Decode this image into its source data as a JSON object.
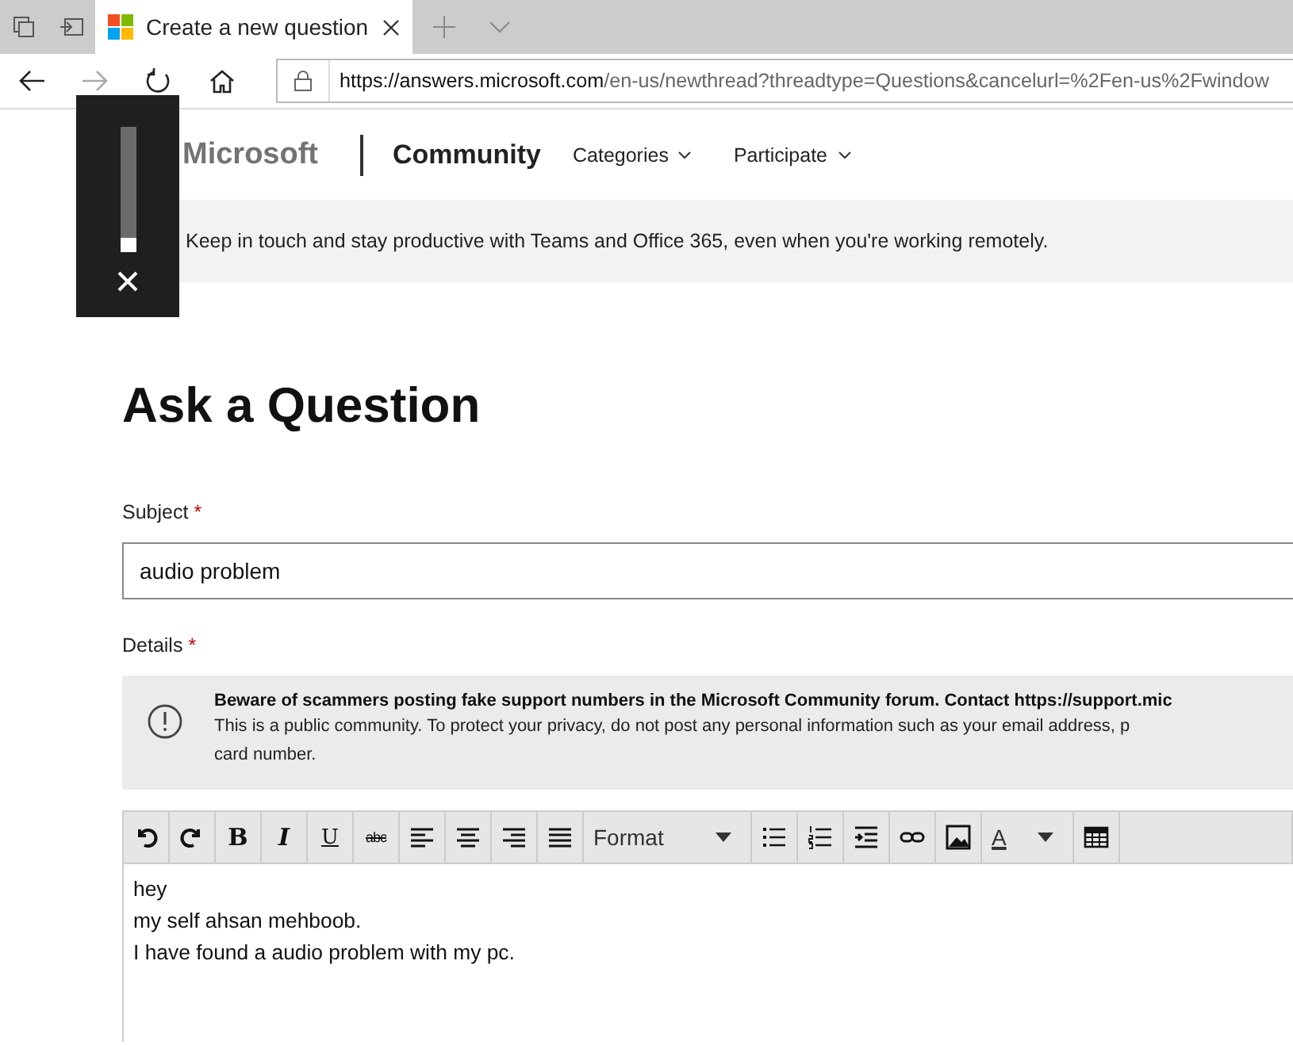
{
  "browser": {
    "tab": {
      "title": "Create a new question",
      "selected": true
    },
    "url": {
      "host": "https://answers.microsoft.com",
      "path": "/en-us/newthread?threadtype=Questions&cancelurl=%2Fen-us%2Fwindow"
    }
  },
  "header": {
    "brand": "Microsoft",
    "site": "Community",
    "menus": [
      "Categories",
      "Participate"
    ]
  },
  "banner": "Keep in touch and stay productive with Teams and Office 365, even when you're working remotely.",
  "form": {
    "title": "Ask a Question",
    "subject": {
      "label": "Subject",
      "required": "*",
      "value": "audio problem"
    },
    "details": {
      "label": "Details",
      "required": "*"
    },
    "warning": {
      "title": "Beware of scammers posting fake support numbers in the Microsoft Community forum. Contact https://support.mic",
      "text": "This is a public community. To protect your privacy, do not post any personal information such as your email address, p\ncard number."
    },
    "tools": [
      {
        "kind": "undo"
      },
      {
        "kind": "redo"
      },
      {
        "kind": "bold",
        "label": "B"
      },
      {
        "kind": "italic",
        "label": "I"
      },
      {
        "kind": "underline",
        "label": "U"
      },
      {
        "kind": "strike",
        "label": "abc"
      },
      {
        "kind": "align-left"
      },
      {
        "kind": "align-center"
      },
      {
        "kind": "align-right"
      },
      {
        "kind": "justify"
      },
      {
        "kind": "dropdown",
        "label": "Format"
      },
      {
        "kind": "bullets"
      },
      {
        "kind": "numbers"
      },
      {
        "kind": "indent"
      },
      {
        "kind": "link"
      },
      {
        "kind": "image"
      },
      {
        "kind": "color",
        "label": "A"
      },
      {
        "kind": "table"
      }
    ],
    "body": [
      "hey",
      "my self ahsan mehboob.",
      "I have found a audio problem with my pc."
    ]
  },
  "volume_flyout": {
    "level": 0.12
  }
}
